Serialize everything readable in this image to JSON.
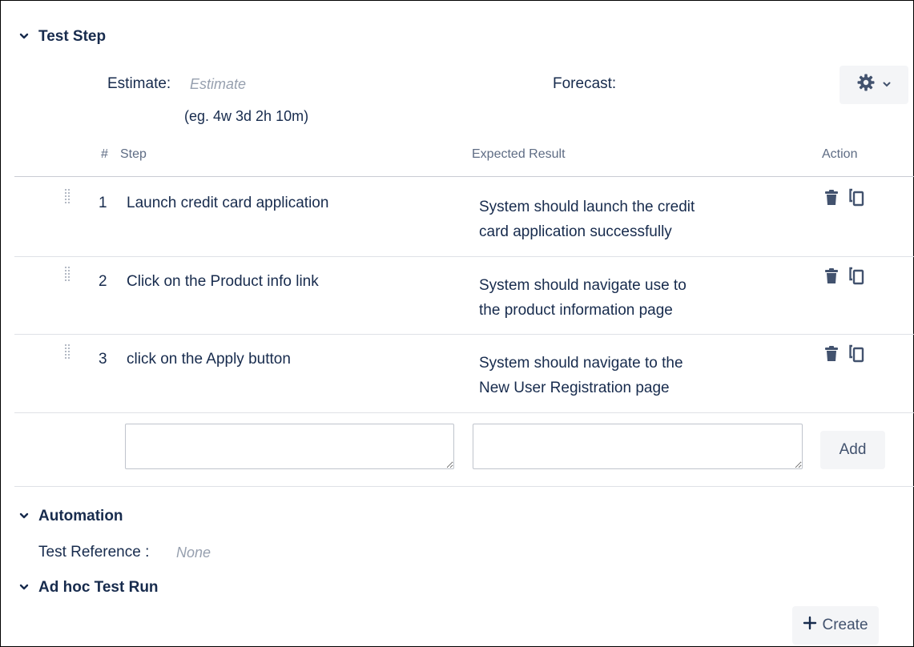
{
  "test_step": {
    "section_title": "Test Step",
    "estimate_label": "Estimate:",
    "estimate_placeholder": "Estimate",
    "estimate_hint": "(eg. 4w 3d 2h 10m)",
    "forecast_label": "Forecast:",
    "columns": {
      "num": "#",
      "step": "Step",
      "expected": "Expected Result",
      "action": "Action"
    },
    "rows": [
      {
        "num": "1",
        "step": "Launch credit card application",
        "expected_line1": "System should launch the credit",
        "expected_line2": "card application successfully"
      },
      {
        "num": "2",
        "step": "Click on the Product info link",
        "expected_line1": "System should navigate use to",
        "expected_line2": "the product information page"
      },
      {
        "num": "3",
        "step": "click on the Apply button",
        "expected_line1": "System should navigate to the",
        "expected_line2": "New User Registration page"
      }
    ],
    "add_label": "Add"
  },
  "automation": {
    "section_title": "Automation",
    "test_reference_label": "Test Reference :",
    "test_reference_value": "None"
  },
  "adhoc": {
    "section_title": "Ad hoc Test Run",
    "create_label": "Create"
  },
  "icons": {
    "section_toggle": "chevron-down-icon",
    "settings": "gear-icon",
    "settings_menu": "chevron-down-icon",
    "delete": "trash-icon",
    "copy": "copy-icon",
    "drag": "drag-handle-icon",
    "create": "plus-icon"
  },
  "colors": {
    "text": "#172b4d",
    "muted": "#97a0af",
    "button_bg": "#f4f5f7",
    "divider": "#dfe1e6"
  }
}
